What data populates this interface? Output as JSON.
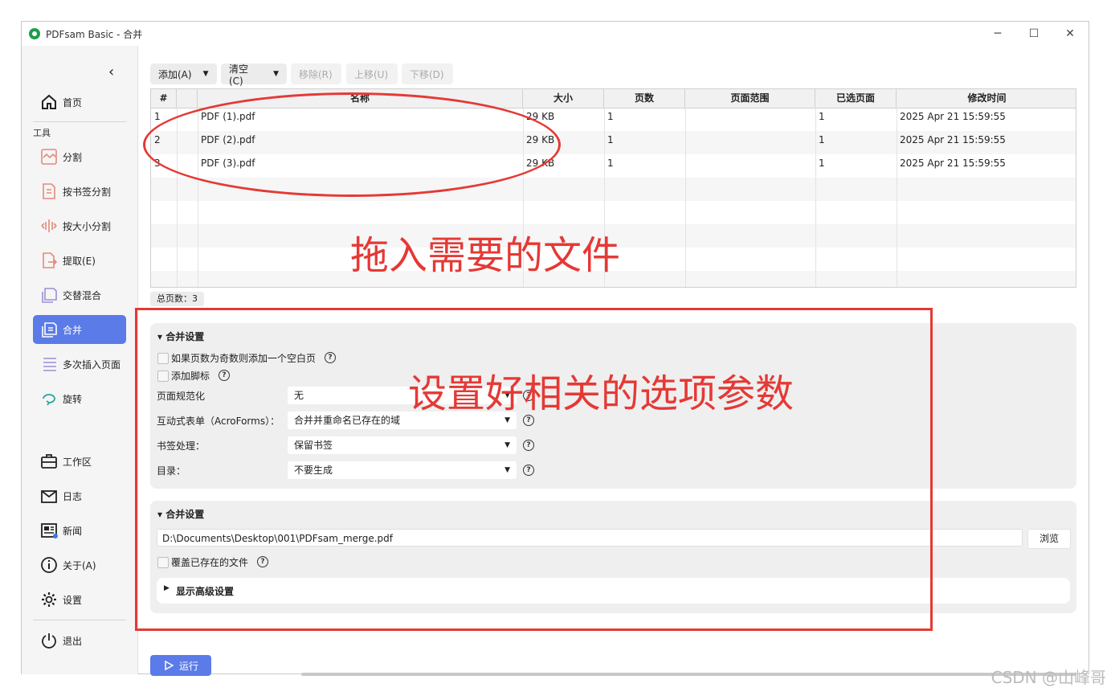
{
  "window": {
    "title": "PDFsam Basic - 合并",
    "minimize": "─",
    "maximize": "☐",
    "close": "✕"
  },
  "sidebar": {
    "collapse": "‹",
    "section_tools": "工具",
    "items": [
      {
        "label": "首页",
        "icon": "home-icon"
      },
      {
        "label": "分割",
        "icon": "split-icon"
      },
      {
        "label": "按书签分割",
        "icon": "bookmark-split-icon"
      },
      {
        "label": "按大小分割",
        "icon": "size-split-icon"
      },
      {
        "label": "提取(E)",
        "icon": "extract-icon"
      },
      {
        "label": "交替混合",
        "icon": "alternate-mix-icon"
      },
      {
        "label": "合并",
        "icon": "merge-icon"
      },
      {
        "label": "多次插入页面",
        "icon": "insert-pages-icon"
      },
      {
        "label": "旋转",
        "icon": "rotate-icon"
      },
      {
        "label": "工作区",
        "icon": "workspace-icon"
      },
      {
        "label": "日志",
        "icon": "log-icon"
      },
      {
        "label": "新闻",
        "icon": "news-icon"
      },
      {
        "label": "关于(A)",
        "icon": "info-icon"
      },
      {
        "label": "设置",
        "icon": "gear-icon"
      },
      {
        "label": "退出",
        "icon": "power-icon"
      }
    ]
  },
  "toolbar": {
    "add": "添加(A)",
    "clear": "清空(C)",
    "remove": "移除(R)",
    "move_up": "上移(U)",
    "move_down": "下移(D)"
  },
  "table": {
    "columns": [
      "#",
      "",
      "名称",
      "大小",
      "页数",
      "页面范围",
      "已选页面",
      "修改时间"
    ],
    "rows": [
      {
        "num": "1",
        "name": "PDF (1).pdf",
        "size": "29 KB",
        "pages": "1",
        "range": "",
        "selected": "1",
        "modified": "2025 Apr 21 15:59:55"
      },
      {
        "num": "2",
        "name": "PDF (2).pdf",
        "size": "29 KB",
        "pages": "1",
        "range": "",
        "selected": "1",
        "modified": "2025 Apr 21 15:59:55"
      },
      {
        "num": "3",
        "name": "PDF (3).pdf",
        "size": "29 KB",
        "pages": "1",
        "range": "",
        "selected": "1",
        "modified": "2025 Apr 21 15:59:55"
      }
    ]
  },
  "total_pages": "总页数：3",
  "merge_settings": {
    "title": "合并设置",
    "add_blank": "如果页数为奇数则添加一个空白页",
    "add_footer": "添加脚标",
    "normalize_label": "页面规范化",
    "normalize_value": "无",
    "acroforms_label": "互动式表单（AcroForms）：",
    "acroforms_value": "合并并重命名已存在的域",
    "bookmarks_label": "书签处理：",
    "bookmarks_value": "保留书签",
    "toc_label": "目录：",
    "toc_value": "不要生成"
  },
  "output_settings": {
    "title": "合并设置",
    "path": "D:\\Documents\\Desktop\\001\\PDFsam_merge.pdf",
    "browse": "浏览",
    "overwrite": "覆盖已存在的文件",
    "advanced": "显示高级设置"
  },
  "run": "运行",
  "annotations": {
    "drag_files": "拖入需要的文件",
    "set_options": "设置好相关的选项参数"
  },
  "watermark": "CSDN @山峰哥",
  "colors": {
    "accent": "#5b7be8",
    "annotation": "#e53935"
  }
}
